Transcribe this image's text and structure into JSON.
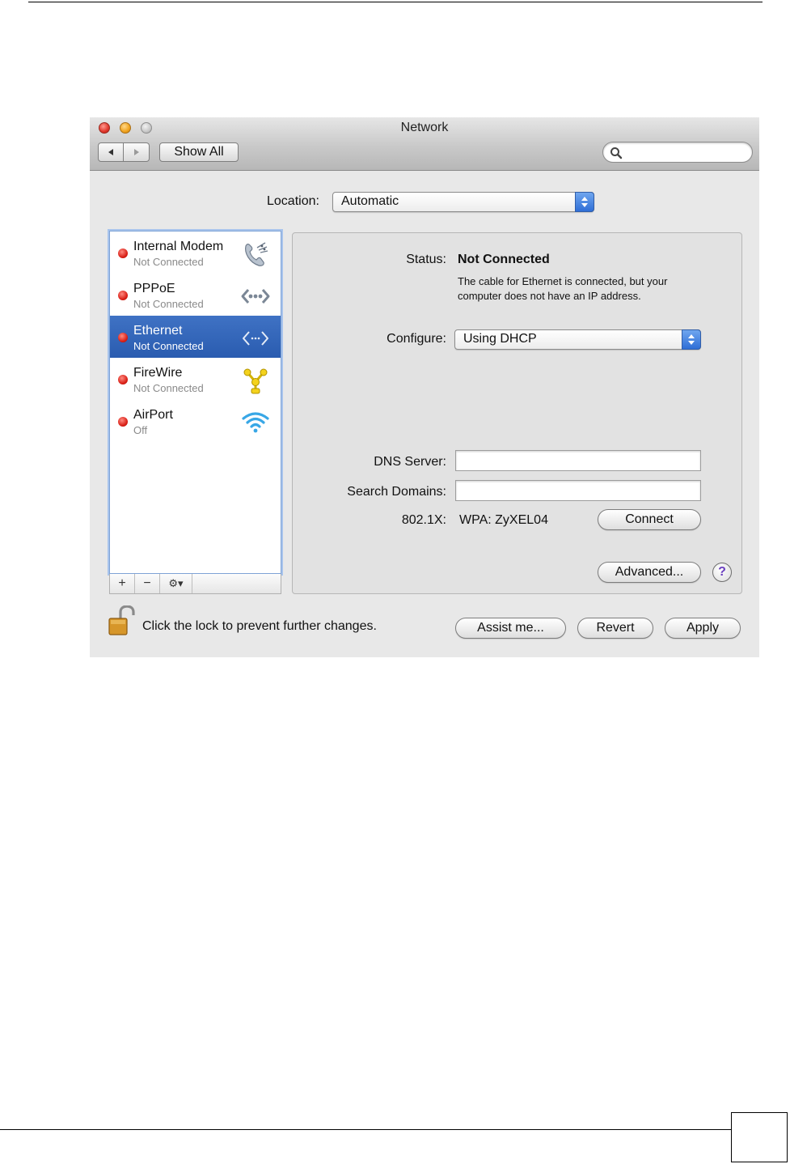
{
  "window": {
    "title": "Network",
    "show_all_label": "Show All",
    "search": {
      "placeholder": ""
    }
  },
  "location": {
    "label": "Location:",
    "value": "Automatic"
  },
  "services": [
    {
      "name": "Internal Modem",
      "status": "Not Connected",
      "icon": "phone-modem-icon",
      "selected": false
    },
    {
      "name": "PPPoE",
      "status": "Not Connected",
      "icon": "pppoe-arrows-icon",
      "selected": false
    },
    {
      "name": "Ethernet",
      "status": "Not Connected",
      "icon": "ethernet-arrows-icon",
      "selected": true
    },
    {
      "name": "FireWire",
      "status": "Not Connected",
      "icon": "firewire-icon",
      "selected": false
    },
    {
      "name": "AirPort",
      "status": "Off",
      "icon": "wifi-icon",
      "selected": false
    }
  ],
  "list_toolbar": {
    "add": "+",
    "remove": "−",
    "action": "⚙▾"
  },
  "detail": {
    "status_label": "Status:",
    "status_value": "Not Connected",
    "status_description": "The cable for Ethernet is connected, but your computer does not have an IP address.",
    "configure_label": "Configure:",
    "configure_value": "Using DHCP",
    "dns_label": "DNS Server:",
    "dns_value": "",
    "search_domains_label": "Search Domains:",
    "search_domains_value": "",
    "dot1x_label": "802.1X:",
    "dot1x_value": "WPA: ZyXEL04",
    "connect_label": "Connect",
    "advanced_label": "Advanced...",
    "help_label": "?"
  },
  "footer": {
    "lock_text": "Click the lock to prevent further changes.",
    "assist_label": "Assist me...",
    "revert_label": "Revert",
    "apply_label": "Apply"
  }
}
